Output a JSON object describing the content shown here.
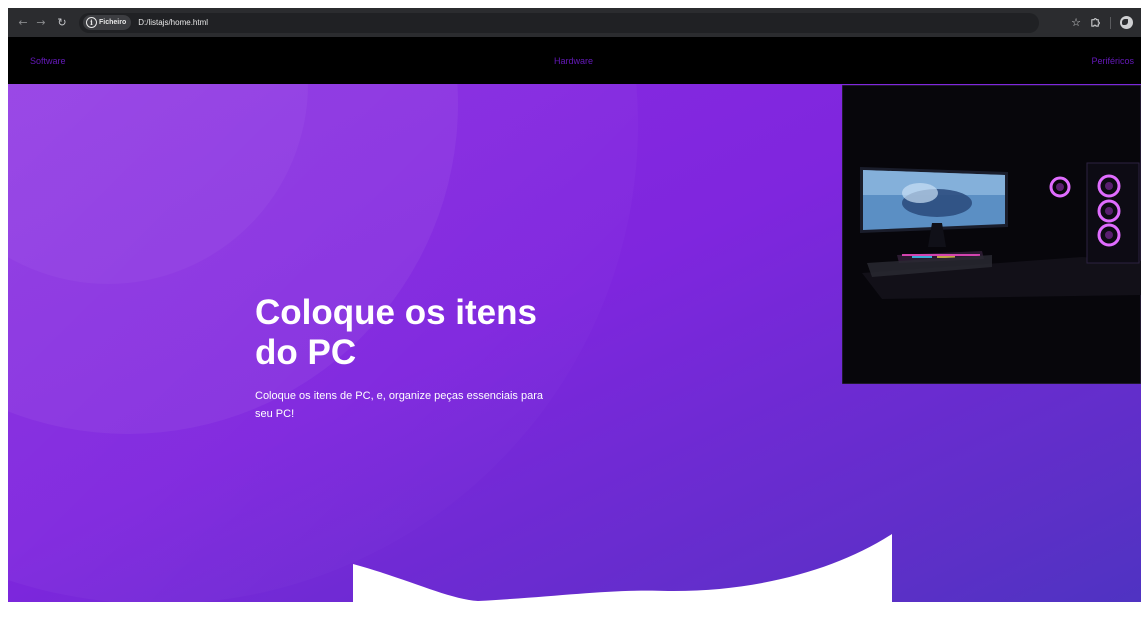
{
  "browser": {
    "back_icon": "arrow-left-icon",
    "forward_icon": "arrow-right-icon",
    "reload_icon": "reload-icon",
    "site_info_label": "Ficheiro",
    "url": "D:/listajs/home.html",
    "bookmark_icon": "star-icon",
    "extensions_icon": "puzzle-icon",
    "profile_icon": "profile-icon"
  },
  "nav": {
    "links": [
      "Software",
      "Hardware",
      "Periféricos"
    ],
    "link_color": "#6419b8",
    "background": "#000000"
  },
  "hero": {
    "title": "Coloque os itens do PC",
    "text": "Coloque os itens de PC, e, organize peças essenciais para seu PC!",
    "gradient_colors": [
      "#8a2be2",
      "#4f33c2"
    ],
    "image": "gaming-pc-setup-photo"
  }
}
